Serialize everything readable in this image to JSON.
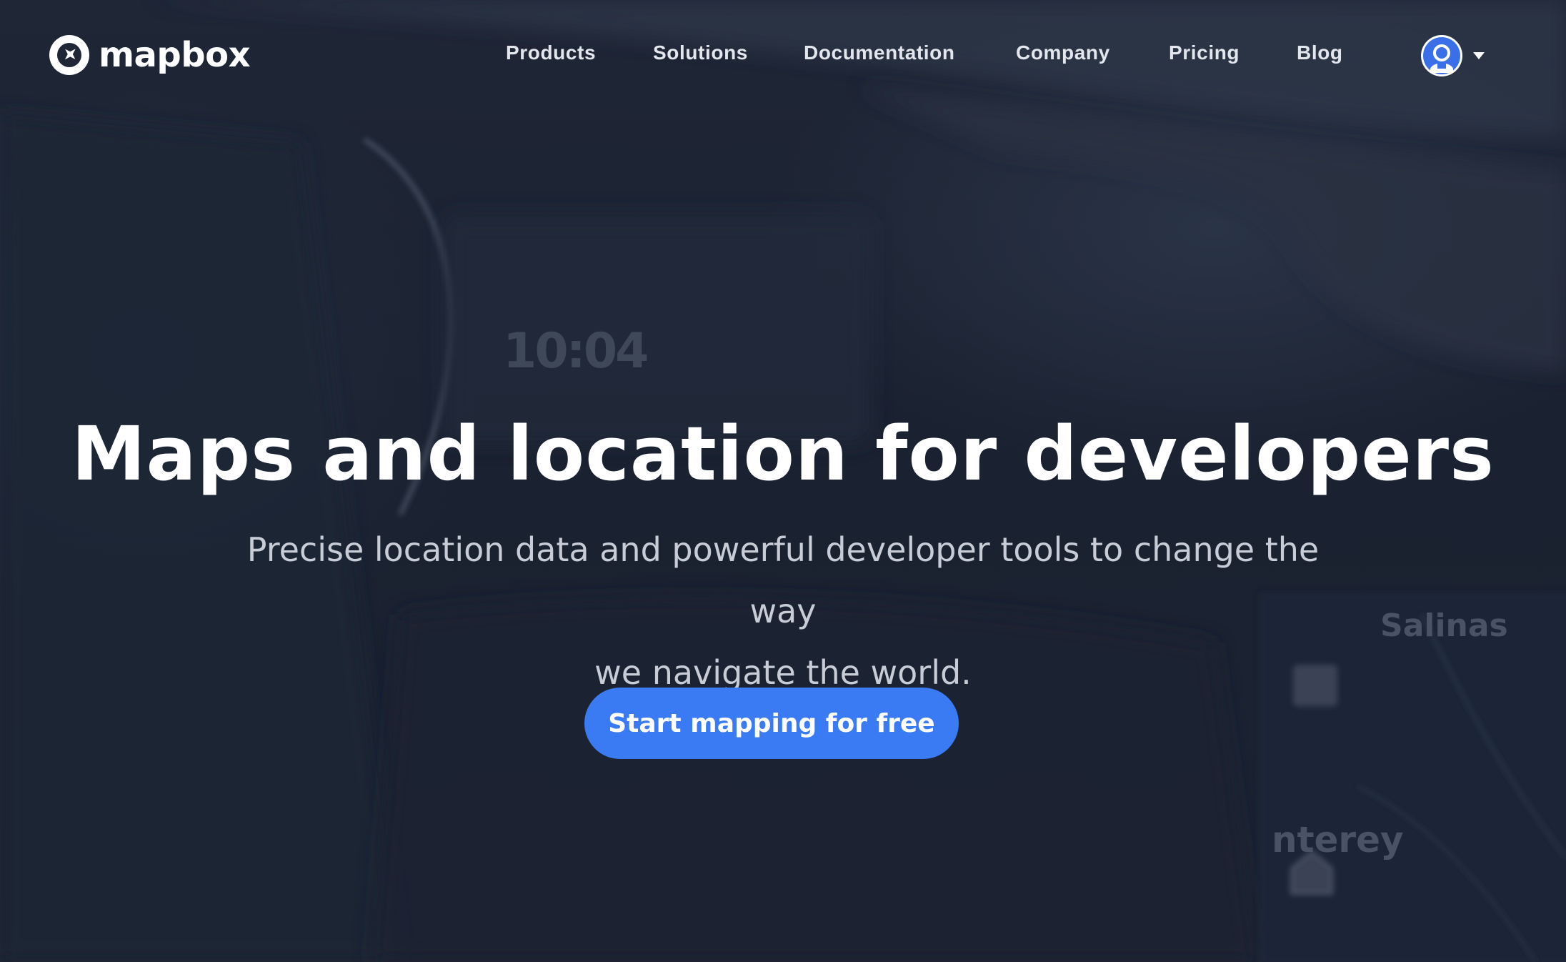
{
  "brand": {
    "name": "mapbox",
    "accent_color": "#3a7bf4"
  },
  "nav": {
    "links": [
      {
        "label": "Products"
      },
      {
        "label": "Solutions"
      },
      {
        "label": "Documentation"
      },
      {
        "label": "Company"
      },
      {
        "label": "Pricing"
      },
      {
        "label": "Blog"
      }
    ],
    "account_icon": "user-avatar-icon",
    "menu_icon": "caret-down-icon"
  },
  "hero": {
    "title": "Maps and location for developers",
    "subtitle_line1": "Precise location data and powerful developer tools to change the way",
    "subtitle_line2": "we navigate the world.",
    "cta_label": "Start mapping for free"
  },
  "background": {
    "clock_text": "10:04",
    "map_labels": [
      "Salinas",
      "nterey"
    ]
  }
}
